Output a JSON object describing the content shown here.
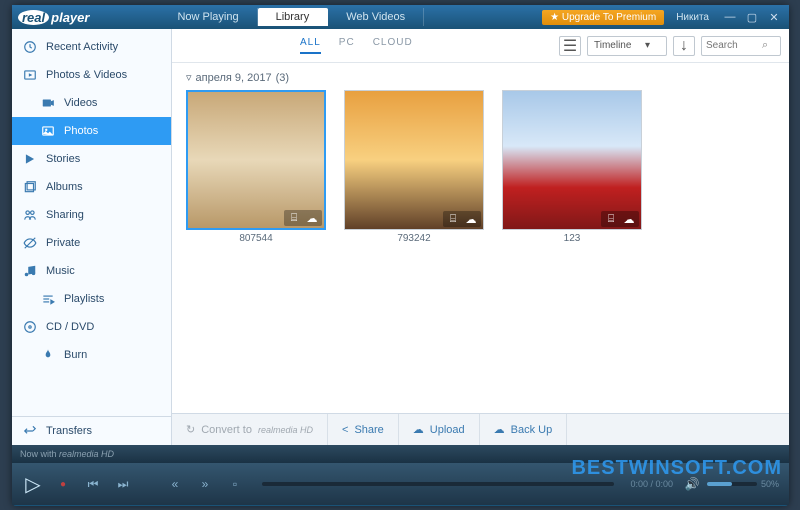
{
  "app": {
    "logo_prefix": "real",
    "logo_suffix": "player"
  },
  "tabs": {
    "now_playing": "Now Playing",
    "library": "Library",
    "web_videos": "Web Videos"
  },
  "title": {
    "upgrade": "Upgrade To Premium",
    "user": "Никита"
  },
  "sidebar": {
    "recent": "Recent Activity",
    "photos_videos": "Photos & Videos",
    "videos": "Videos",
    "photos": "Photos",
    "stories": "Stories",
    "albums": "Albums",
    "sharing": "Sharing",
    "private": "Private",
    "music": "Music",
    "playlists": "Playlists",
    "cddvd": "CD / DVD",
    "burn": "Burn",
    "transfers": "Transfers"
  },
  "filters": {
    "all": "ALL",
    "pc": "PC",
    "cloud": "CLOUD"
  },
  "sort": {
    "label": "Timeline"
  },
  "search": {
    "placeholder": "Search"
  },
  "group": {
    "date": "апреля 9, 2017",
    "count": "(3)"
  },
  "items": [
    {
      "label": "807544"
    },
    {
      "label": "793242"
    },
    {
      "label": "123"
    }
  ],
  "actions": {
    "convert": "Convert to",
    "convert_brand": "realmedia HD",
    "share": "Share",
    "upload": "Upload",
    "backup": "Back Up"
  },
  "bottom": {
    "nowwith": "Now with",
    "brand": "realmedia HD"
  },
  "player": {
    "time1": "0:00 / 0:00",
    "vol": "50%"
  },
  "watermark": "BESTWINSOFT.COM"
}
